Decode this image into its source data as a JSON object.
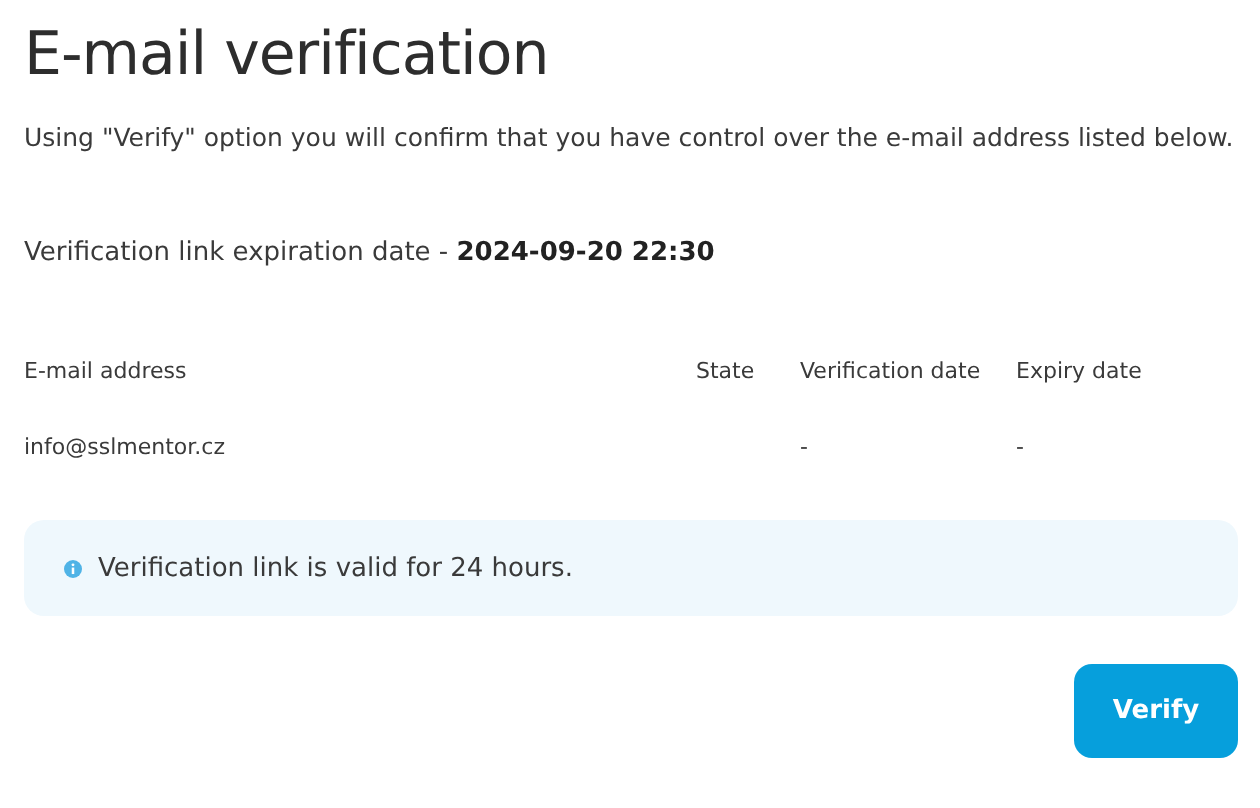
{
  "title": "E-mail verification",
  "description": "Using \"Verify\" option you will confirm that you have control over the e-mail address listed below.",
  "expiration": {
    "label": "Verification link expiration date - ",
    "value": "2024-09-20 22:30"
  },
  "table": {
    "columns": [
      "E-mail address",
      "State",
      "Verification date",
      "Expiry date"
    ],
    "rows": [
      [
        "info@sslmentor.cz",
        "",
        "-",
        "-"
      ]
    ]
  },
  "info": "Verification link is valid for 24 hours.",
  "buttons": [
    "Verify"
  ]
}
